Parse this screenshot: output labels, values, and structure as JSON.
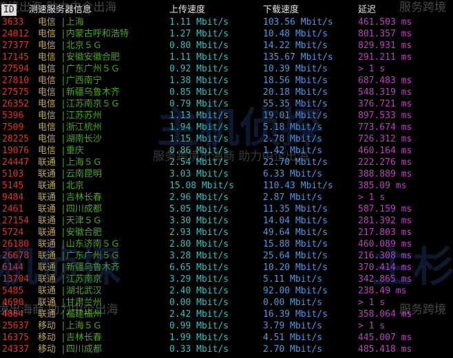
{
  "header": {
    "id": "ID",
    "server": "测速服务器信息",
    "upload": "上传速度",
    "download": "下载速度",
    "latency": "延迟"
  },
  "rows": [
    {
      "id": "3633",
      "isp": "电信",
      "loc": "|上海",
      "up": "1.11 Mbit/s",
      "down": "103.56 Mbit/s",
      "lat": "461.503 ms"
    },
    {
      "id": "24012",
      "isp": "电信",
      "loc": "|内蒙古呼和浩特",
      "up": "1.27 Mbit/s",
      "down": "10.48 Mbit/s",
      "lat": "801.357 ms"
    },
    {
      "id": "27377",
      "isp": "电信",
      "loc": "|北京５Ｇ",
      "up": "0.80 Mbit/s",
      "down": "14.22 Mbit/s",
      "lat": "829.931 ms"
    },
    {
      "id": "17145",
      "isp": "电信",
      "loc": "|安徽安徽合肥",
      "up": "1.11 Mbit/s",
      "down": "135.67 Mbit/s",
      "lat": "291.211 ms"
    },
    {
      "id": "27594",
      "isp": "电信",
      "loc": "|广东广州５Ｇ",
      "up": "0.92 Mbit/s",
      "down": "10.39 Mbit/s",
      "lat": "> 1 s"
    },
    {
      "id": "27810",
      "isp": "电信",
      "loc": "|广西南宁",
      "up": "1.38 Mbit/s",
      "down": "18.56 Mbit/s",
      "lat": "687.483 ms"
    },
    {
      "id": "27575",
      "isp": "电信",
      "loc": "|新疆乌鲁木齐",
      "up": "0.85 Mbit/s",
      "down": "20.18 Mbit/s",
      "lat": "548.319 ms"
    },
    {
      "id": "26352",
      "isp": "电信",
      "loc": "|江苏南京５Ｇ",
      "up": "0.79 Mbit/s",
      "down": "55.35 Mbit/s",
      "lat": "376.721 ms"
    },
    {
      "id": "5396",
      "isp": "电信",
      "loc": "|江苏苏州",
      "up": "1.13 Mbit/s",
      "down": "19.01 Mbit/s",
      "lat": "897.533 ms"
    },
    {
      "id": "7509",
      "isp": "电信",
      "loc": "|浙江杭州",
      "up": "1.94 Mbit/s",
      "down": "5.18 Mbit/s",
      "lat": "773.674 ms"
    },
    {
      "id": "28225",
      "isp": "电信",
      "loc": "|湖南长沙",
      "up": "1.15 Mbit/s",
      "down": "2.78 Mbit/s",
      "lat": "726.312 ms"
    },
    {
      "id": "19076",
      "isp": "电信",
      "loc": "|重庆",
      "up": "0.86 Mbit/s",
      "down": "1.42 Mbit/s",
      "lat": "460.164 ms"
    },
    {
      "id": "24447",
      "isp": "联通",
      "loc": "|上海５Ｇ",
      "up": "2.54 Mbit/s",
      "down": "22.70 Mbit/s",
      "lat": "222.276 ms"
    },
    {
      "id": "5103",
      "isp": "联通",
      "loc": "|云南昆明",
      "up": "3.03 Mbit/s",
      "down": "6.33 Mbit/s",
      "lat": "388.889 ms"
    },
    {
      "id": "5145",
      "isp": "联通",
      "loc": "|北京",
      "up": "15.08 Mbit/s",
      "down": "110.43 Mbit/s",
      "lat": "385.09 ms"
    },
    {
      "id": "9484",
      "isp": "联通",
      "loc": "|吉林长春",
      "up": "2.96 Mbit/s",
      "down": "2.87 Mbit/s",
      "lat": "> 1 s"
    },
    {
      "id": "2461",
      "isp": "联通",
      "loc": "|四川成都",
      "up": "5.05 Mbit/s",
      "down": "11.35 Mbit/s",
      "lat": "587.159 ms"
    },
    {
      "id": "27154",
      "isp": "联通",
      "loc": "|天津５Ｇ",
      "up": "3.30 Mbit/s",
      "down": "14.04 Mbit/s",
      "lat": "281.392 ms"
    },
    {
      "id": "5724",
      "isp": "联通",
      "loc": "|安徽合肥",
      "up": "2.93 Mbit/s",
      "down": "49.64 Mbit/s",
      "lat": "217.803 ms"
    },
    {
      "id": "26180",
      "isp": "联通",
      "loc": "|山东济南５Ｇ",
      "up": "2.80 Mbit/s",
      "down": "15.88 Mbit/s",
      "lat": "460.089 ms"
    },
    {
      "id": "26678",
      "isp": "联通",
      "loc": "|广东广州５Ｇ",
      "up": "3.28 Mbit/s",
      "down": "25.64 Mbit/s",
      "lat": "216.308 ms"
    },
    {
      "id": "6144",
      "isp": "联通",
      "loc": "|新疆乌鲁木齐",
      "up": "6.65 Mbit/s",
      "down": "10.20 Mbit/s",
      "lat": "370.414 ms"
    },
    {
      "id": "13704",
      "isp": "联通",
      "loc": "|江苏南京",
      "up": "3.29 Mbit/s",
      "down": "5.11 Mbit/s",
      "lat": "342.865 ms"
    },
    {
      "id": "5485",
      "isp": "联通",
      "loc": "|湖北武汉",
      "up": "2.40 Mbit/s",
      "down": "92.00 Mbit/s",
      "lat": "238.49 ms"
    },
    {
      "id": "4690",
      "isp": "联通",
      "loc": "|甘肃兰州",
      "up": "0.00 Mbit/s",
      "down": "0.00 Mbit/s",
      "lat": "> 1 s"
    },
    {
      "id": "4884",
      "isp": "联通",
      "loc": "|福建福州",
      "up": "2.42 Mbit/s",
      "down": "16.39 Mbit/s",
      "lat": "358.064 ms"
    },
    {
      "id": "25637",
      "isp": "移动",
      "loc": "|上海５Ｇ",
      "up": "0.99 Mbit/s",
      "down": "3.79 Mbit/s",
      "lat": "> 1 s"
    },
    {
      "id": "16375",
      "isp": "移动",
      "loc": "|吉林长春",
      "up": "1.99 Mbit/s",
      "down": "4.51 Mbit/s",
      "lat": "445.007 ms"
    },
    {
      "id": "24337",
      "isp": "移动",
      "loc": "|四川成都",
      "up": "0.33 Mbit/s",
      "down": "2.70 Mbit/s",
      "lat": "485.418 ms"
    }
  ],
  "watermarks": {
    "top_left": "跨境出海·助力中企出海",
    "top_right": "服务跨境",
    "center_logo": "主机侦探",
    "center_sub": "服务跨境出海商 助力中企出海",
    "left_logo": "机侦探",
    "right_logo": "主杉",
    "bottom_left": "境出海商 助力中企出海",
    "bottom_right": "服务跨境"
  }
}
